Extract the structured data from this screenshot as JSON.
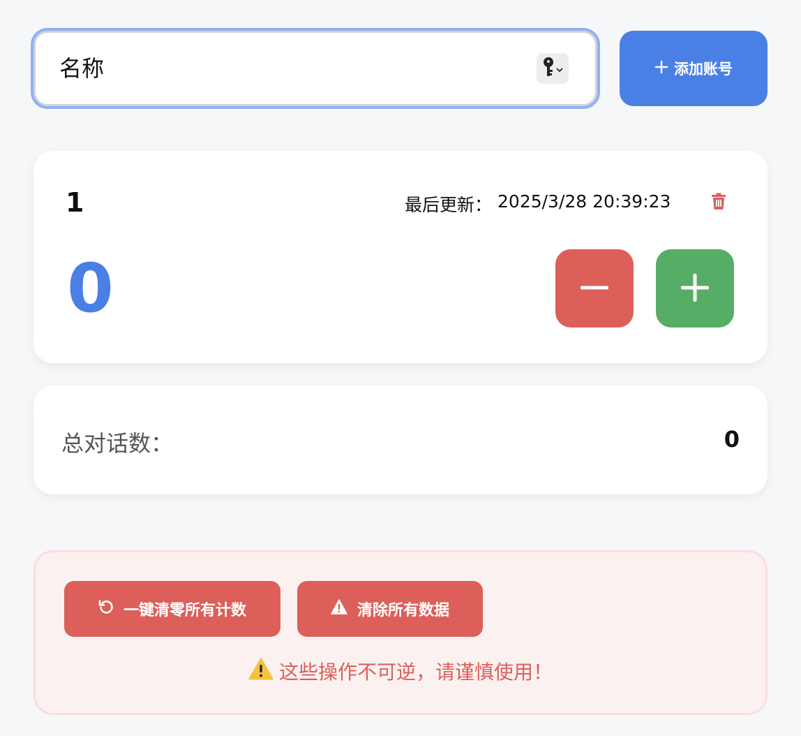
{
  "top": {
    "name_placeholder": "名称",
    "key_icon": "key-icon",
    "add_button_label": "添加账号",
    "add_icon": "plus-icon"
  },
  "account": {
    "name": "1",
    "last_updated_label": "最后更新：",
    "last_updated_value": "2025/3/28 20:39:23",
    "count": "0",
    "delete_icon": "trash-icon",
    "decrement_icon": "minus-icon",
    "increment_icon": "plus-icon"
  },
  "total": {
    "label": "总对话数：",
    "value": "0"
  },
  "danger": {
    "reset_label": "一键清零所有计数",
    "reset_icon": "undo-icon",
    "clear_label": "清除所有数据",
    "clear_icon": "warning-icon",
    "warning_emoji": "⚠️",
    "warning_text": "这些操作不可逆，请谨慎使用！"
  },
  "colors": {
    "accent_blue": "#4a80e6",
    "danger_red": "#dc5f5a",
    "success_green": "#56ad66",
    "background": "#f6f7f9"
  }
}
